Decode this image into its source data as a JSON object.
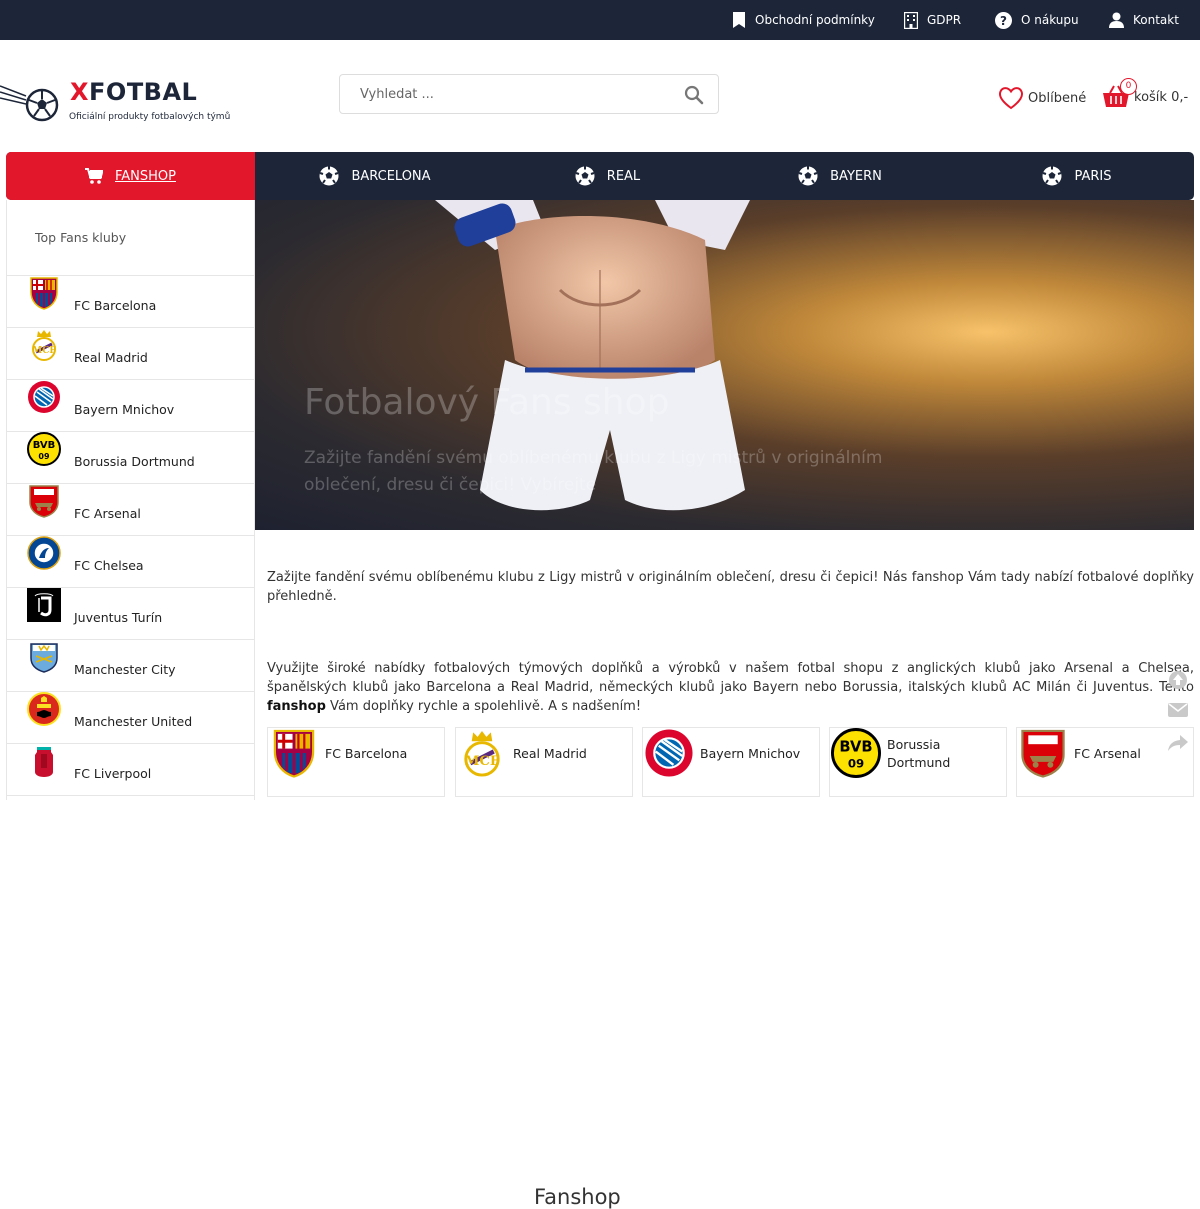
{
  "topbar": {
    "links": [
      {
        "label": "Obchodní podmínky",
        "icon": "bookmark-icon"
      },
      {
        "label": "GDPR",
        "icon": "building-icon"
      },
      {
        "label": "O nákupu",
        "icon": "question-circle-icon"
      },
      {
        "label": "Kontakt",
        "icon": "user-icon"
      }
    ]
  },
  "header": {
    "logo_x": "X",
    "logo_rest": "FOTBAL",
    "tagline": "Oficiální produkty fotbalových týmů",
    "search_placeholder": "Vyhledat ...",
    "favorites_label": "Oblíbené",
    "cart_label": "košík 0,-",
    "cart_count": "0"
  },
  "nav": {
    "items": [
      {
        "label": "FANSHOP",
        "icon": "cart-icon",
        "active": true
      },
      {
        "label": "BARCELONA",
        "icon": "soccer-ball-icon"
      },
      {
        "label": "REAL",
        "icon": "soccer-ball-icon"
      },
      {
        "label": "BAYERN",
        "icon": "soccer-ball-icon"
      },
      {
        "label": "PARIS",
        "icon": "soccer-ball-icon"
      }
    ]
  },
  "sidebar": {
    "title": "Top Fans kluby",
    "clubs": [
      {
        "name": "FC Barcelona"
      },
      {
        "name": "Real Madrid"
      },
      {
        "name": "Bayern Mnichov"
      },
      {
        "name": "Borussia Dortmund"
      },
      {
        "name": "FC Arsenal"
      },
      {
        "name": "FC Chelsea"
      },
      {
        "name": "Juventus Turín"
      },
      {
        "name": "Manchester City"
      },
      {
        "name": "Manchester United"
      },
      {
        "name": "FC Liverpool"
      }
    ]
  },
  "hero": {
    "title": "Fotbalový Fans shop",
    "subtitle": "Zažijte fandění svému oblíbenému klubu z Ligy mistrů v originálním oblečení, dresu či čepici! Vybírejte"
  },
  "content": {
    "intro": "Zažijte fandění svému oblíbenému klubu z Ligy mistrů v originálním oblečení, dresu či čepici! Nás fanshop Vám tady nabízí fotbalové doplňky přehledně.",
    "heading": "Fanshop",
    "para_before": "Využijte široké nabídky fotbalových týmových doplňků a výrobků v našem fotbal shopu z anglických klubů jako Arsenal a Chelsea, španělských klubů jako Barcelona a Real Madrid, německých klubů jako Bayern nebo Borussia, italských klubů AC Milán či Juventus. Tento ",
    "para_bold": "fanshop",
    "para_after": " Vám doplňky rychle a spolehlivě. A s nadšením!"
  },
  "cards": [
    {
      "name": "FC Barcelona"
    },
    {
      "name": "Real Madrid"
    },
    {
      "name": "Bayern Mnichov"
    },
    {
      "name": "Borussia Dortmund"
    },
    {
      "name": "FC Arsenal"
    }
  ],
  "colors": {
    "navy": "#1d2639",
    "accent": "#e3172c"
  }
}
